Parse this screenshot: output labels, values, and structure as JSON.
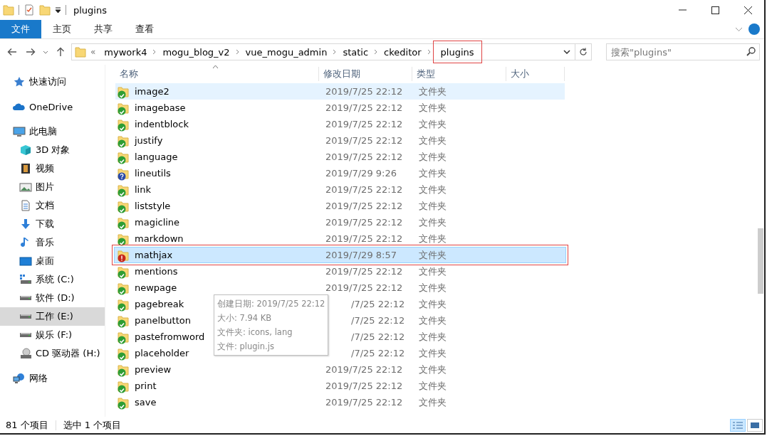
{
  "window": {
    "title": "plugins"
  },
  "ribbon": {
    "tabs": [
      {
        "label": "文件",
        "selected": true
      },
      {
        "label": "主页",
        "selected": false
      },
      {
        "label": "共享",
        "selected": false
      },
      {
        "label": "查看",
        "selected": false
      }
    ]
  },
  "address": {
    "overflow": "«",
    "crumbs": [
      {
        "label": "mywork4",
        "highlighted": false
      },
      {
        "label": "mogu_blog_v2",
        "highlighted": false
      },
      {
        "label": "vue_mogu_admin",
        "highlighted": false
      },
      {
        "label": "static",
        "highlighted": false
      },
      {
        "label": "ckeditor",
        "highlighted": false
      },
      {
        "label": "plugins",
        "highlighted": true
      }
    ]
  },
  "search": {
    "placeholder": "搜索\"plugins\""
  },
  "sidebar": {
    "items": [
      {
        "label": "快速访问",
        "kind": "star",
        "selected": false
      },
      {
        "label": "OneDrive",
        "kind": "cloud",
        "selected": false
      },
      {
        "label": "此电脑",
        "kind": "pc",
        "selected": false,
        "children": [
          {
            "label": "3D 对象",
            "kind": "cube",
            "selected": false
          },
          {
            "label": "视频",
            "kind": "film",
            "selected": false
          },
          {
            "label": "图片",
            "kind": "image",
            "selected": false
          },
          {
            "label": "文档",
            "kind": "doc",
            "selected": false
          },
          {
            "label": "下载",
            "kind": "download",
            "selected": false
          },
          {
            "label": "音乐",
            "kind": "music",
            "selected": false
          },
          {
            "label": "桌面",
            "kind": "desktop",
            "selected": false
          },
          {
            "label": "系统 (C:)",
            "kind": "windrive",
            "selected": false
          },
          {
            "label": "软件 (D:)",
            "kind": "drive",
            "selected": false
          },
          {
            "label": "工作 (E:)",
            "kind": "drive",
            "selected": true
          },
          {
            "label": "娱乐 (F:)",
            "kind": "drive",
            "selected": false
          },
          {
            "label": "CD 驱动器 (H:)",
            "kind": "cd",
            "selected": false
          }
        ]
      },
      {
        "label": "网络",
        "kind": "network",
        "selected": false
      }
    ]
  },
  "table": {
    "columns": [
      "名称",
      "修改日期",
      "类型",
      "大小"
    ],
    "rows": [
      {
        "name": "image2",
        "modified": "2019/7/25 22:12",
        "type": "文件夹",
        "kind": "ok",
        "hovered": true,
        "selected": false,
        "highlighted": false
      },
      {
        "name": "imagebase",
        "modified": "2019/7/25 22:12",
        "type": "文件夹",
        "kind": "ok",
        "hovered": false,
        "selected": false,
        "highlighted": false
      },
      {
        "name": "indentblock",
        "modified": "2019/7/25 22:12",
        "type": "文件夹",
        "kind": "ok",
        "hovered": false,
        "selected": false,
        "highlighted": false
      },
      {
        "name": "justify",
        "modified": "2019/7/25 22:12",
        "type": "文件夹",
        "kind": "ok",
        "hovered": false,
        "selected": false,
        "highlighted": false
      },
      {
        "name": "language",
        "modified": "2019/7/25 22:12",
        "type": "文件夹",
        "kind": "ok",
        "hovered": false,
        "selected": false,
        "highlighted": false
      },
      {
        "name": "lineutils",
        "modified": "2019/7/29 9:26",
        "type": "文件夹",
        "kind": "unknown",
        "hovered": false,
        "selected": false,
        "highlighted": false
      },
      {
        "name": "link",
        "modified": "2019/7/25 22:12",
        "type": "文件夹",
        "kind": "ok",
        "hovered": false,
        "selected": false,
        "highlighted": false
      },
      {
        "name": "liststyle",
        "modified": "2019/7/25 22:12",
        "type": "文件夹",
        "kind": "ok",
        "hovered": false,
        "selected": false,
        "highlighted": false
      },
      {
        "name": "magicline",
        "modified": "2019/7/25 22:12",
        "type": "文件夹",
        "kind": "ok",
        "hovered": false,
        "selected": false,
        "highlighted": false
      },
      {
        "name": "markdown",
        "modified": "2019/7/25 22:12",
        "type": "文件夹",
        "kind": "ok",
        "hovered": false,
        "selected": false,
        "highlighted": false
      },
      {
        "name": "mathjax",
        "modified": "2019/7/29 8:57",
        "type": "文件夹",
        "kind": "error",
        "hovered": false,
        "selected": true,
        "highlighted": true
      },
      {
        "name": "mentions",
        "modified": "2019/7/25 22:12",
        "type": "文件夹",
        "kind": "ok",
        "hovered": false,
        "selected": false,
        "highlighted": false
      },
      {
        "name": "newpage",
        "modified": "2019/7/25 22:12",
        "type": "文件夹",
        "kind": "ok",
        "hovered": false,
        "selected": false,
        "highlighted": false
      },
      {
        "name": "pagebreak",
        "modified": "/7/25 22:12",
        "covered": true,
        "type": "文件夹",
        "kind": "ok",
        "hovered": false,
        "selected": false,
        "highlighted": false
      },
      {
        "name": "panelbutton",
        "modified": "/7/25 22:12",
        "covered": true,
        "type": "文件夹",
        "kind": "ok",
        "hovered": false,
        "selected": false,
        "highlighted": false
      },
      {
        "name": "pastefromword",
        "modified": "/7/25 22:12",
        "covered": true,
        "type": "文件夹",
        "kind": "ok",
        "hovered": false,
        "selected": false,
        "highlighted": false
      },
      {
        "name": "placeholder",
        "modified": "/7/25 22:12",
        "covered": true,
        "type": "文件夹",
        "kind": "ok",
        "hovered": false,
        "selected": false,
        "highlighted": false
      },
      {
        "name": "preview",
        "modified": "2019/7/25 22:12",
        "type": "文件夹",
        "kind": "ok",
        "hovered": false,
        "selected": false,
        "highlighted": false
      },
      {
        "name": "print",
        "modified": "2019/7/25 22:12",
        "type": "文件夹",
        "kind": "ok",
        "hovered": false,
        "selected": false,
        "highlighted": false
      },
      {
        "name": "save",
        "modified": "2019/7/25 22:12",
        "type": "文件夹",
        "kind": "ok",
        "hovered": false,
        "selected": false,
        "highlighted": false
      }
    ]
  },
  "tooltip": {
    "lines": [
      "创建日期: 2019/7/25 22:12",
      "大小: 7.94 KB",
      "文件夹: icons, lang",
      "文件: plugin.js"
    ]
  },
  "status_bar": {
    "item_count": "81 个项目",
    "selection": "选中 1 个项目"
  }
}
